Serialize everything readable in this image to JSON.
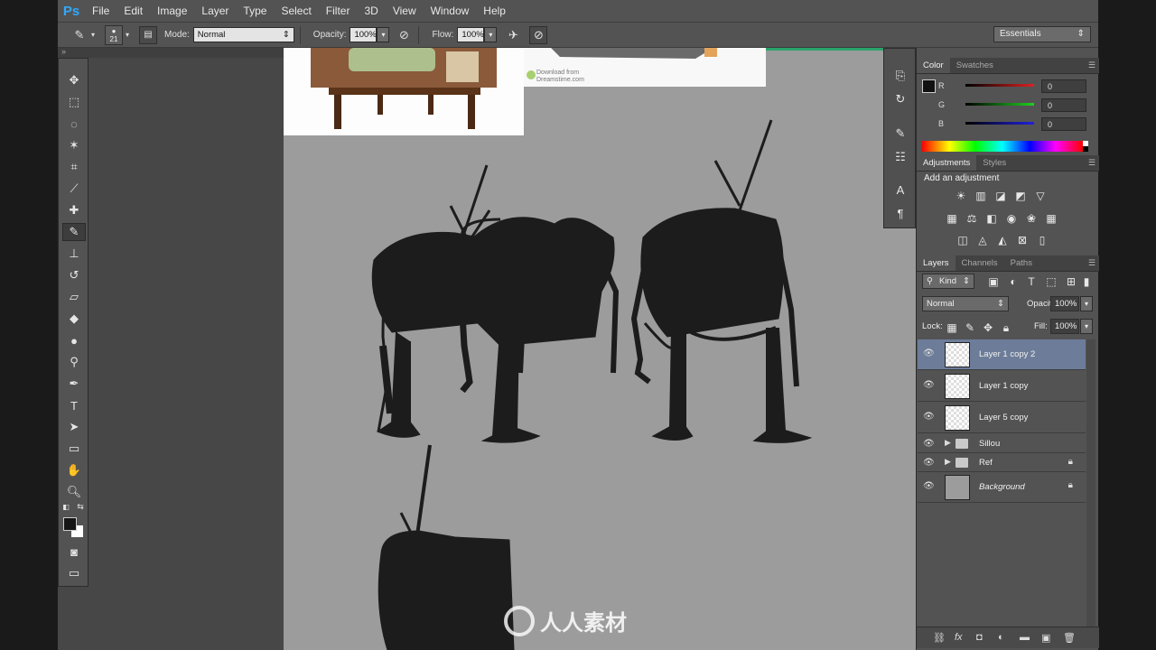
{
  "app": {
    "logo": "Ps"
  },
  "menu": [
    "File",
    "Edit",
    "Image",
    "Layer",
    "Type",
    "Select",
    "Filter",
    "3D",
    "View",
    "Window",
    "Help"
  ],
  "options": {
    "brush_size": "21",
    "mode_label": "Mode:",
    "mode_value": "Normal",
    "opacity_label": "Opacity:",
    "opacity_value": "100%",
    "flow_label": "Flow:",
    "flow_value": "100%",
    "workspace": "Essentials"
  },
  "reference": {
    "download_line1": "Download from",
    "download_line2": "Dreamstime.com"
  },
  "color_panel": {
    "tabs": [
      "Color",
      "Swatches"
    ],
    "sliders": [
      {
        "label": "R",
        "value": "0",
        "color": "#d42a2a"
      },
      {
        "label": "G",
        "value": "0",
        "color": "#2ac42a"
      },
      {
        "label": "B",
        "value": "0",
        "color": "#2a2ad4"
      }
    ]
  },
  "adjustments_panel": {
    "tabs": [
      "Adjustments",
      "Styles"
    ],
    "title": "Add an adjustment"
  },
  "layers_panel": {
    "tabs": [
      "Layers",
      "Channels",
      "Paths"
    ],
    "filter": "Kind",
    "blend_mode": "Normal",
    "opacity_label": "Opacity:",
    "opacity_value": "100%",
    "lock_label": "Lock:",
    "fill_label": "Fill:",
    "fill_value": "100%",
    "layers": [
      {
        "name": "Layer 1 copy 2"
      },
      {
        "name": "Layer 1 copy"
      },
      {
        "name": "Layer 5 copy"
      }
    ],
    "groups": [
      {
        "name": "Sillou"
      },
      {
        "name": "Ref"
      }
    ],
    "background": "Background"
  },
  "watermark": {
    "text": "人人素材"
  },
  "colors": {
    "accent": "#31a8ff",
    "selection": "#6d7d99",
    "canvas": "#9c9c9c",
    "panel": "#535353"
  }
}
